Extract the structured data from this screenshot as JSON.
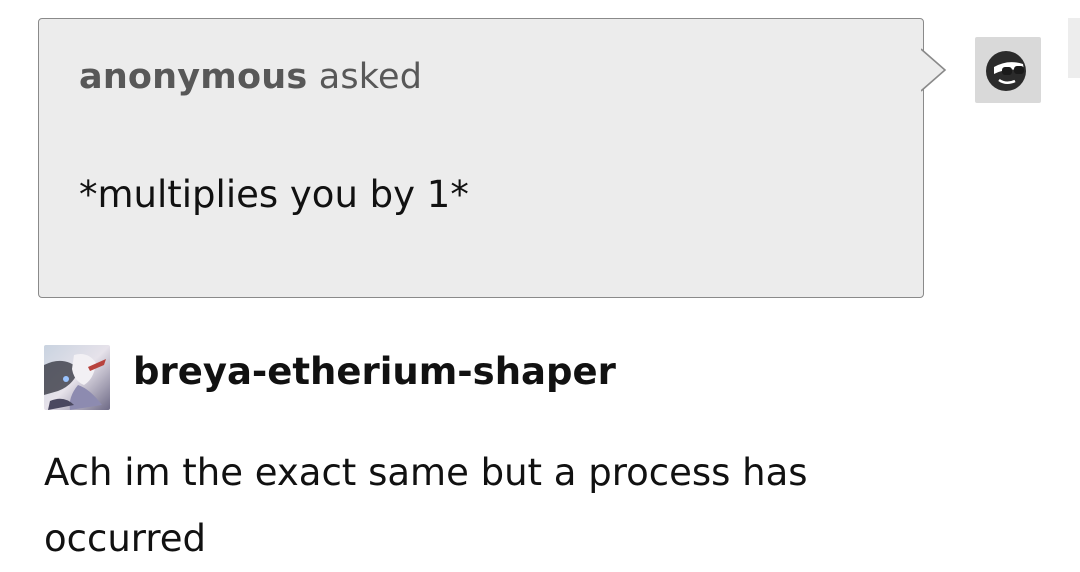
{
  "ask": {
    "asker_name": "anonymous",
    "asked_label": " asked",
    "question": "*multiplies you by 1*",
    "asker_avatar_icon": "cool-face-sunglasses-icon"
  },
  "reblog": {
    "username": "breya-etherium-shaper",
    "avatar_icon": "anime-character-avatar",
    "text": "Ach im the exact same but a process has occurred"
  },
  "colors": {
    "ask_background": "#ececec",
    "ask_border": "#8a8a8a",
    "asker_text": "#585858"
  }
}
